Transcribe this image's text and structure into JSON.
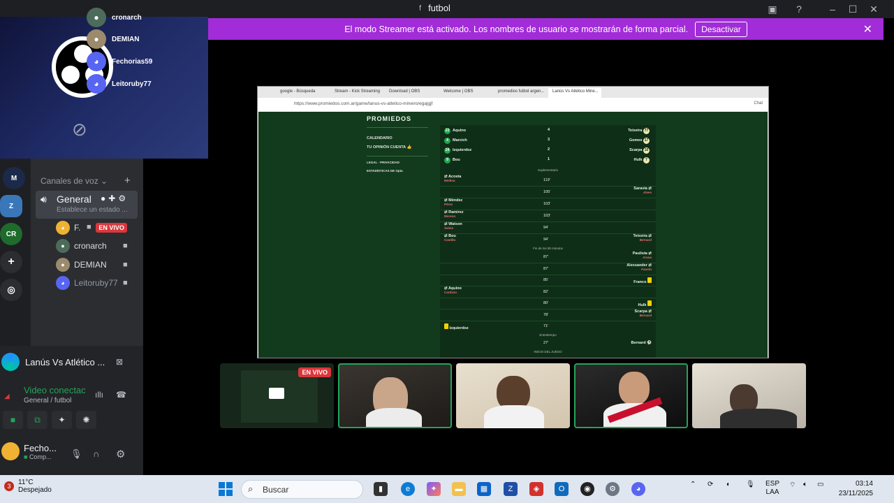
{
  "window": {
    "title": "futbol",
    "hash_icon": "f"
  },
  "streamer_bar": {
    "text": "El modo Streamer está activado. Los nombres de usuario se mostrarán de forma parcial.",
    "button": "Desactivar"
  },
  "overlay_users": [
    "cronarch",
    "DEMIAN",
    "Fechorias59",
    "Leitoruby77"
  ],
  "sidebar": {
    "voice_channels_label": "Canales de voz",
    "channel": {
      "name": "General",
      "status": "Establece un estado ..."
    },
    "voice_users": [
      {
        "name": "F.",
        "live": "EN VIVO"
      },
      {
        "name": "cronarch"
      },
      {
        "name": "DEMIAN"
      },
      {
        "name": "Leitoruby77"
      }
    ]
  },
  "activity": {
    "title": "Lanús Vs Atlético ..."
  },
  "voice": {
    "status": "Video conectac",
    "channel": "General / futbol"
  },
  "user": {
    "name": "Fecho...",
    "sub": "Comp..."
  },
  "browser": {
    "tabs": [
      "google - Búsqueda",
      "Stream - Kick Streaming",
      "Download | OBS",
      "Welcome | OBS",
      "promedios futbol argen...",
      "Lanús Vs Atlético Mine..."
    ],
    "url": "https://www.promiedos.com.ar/game/lanus-vs-atletico-mineiro/egajgjf",
    "chat_label": "Chat"
  },
  "promiedos": {
    "logo": "PROMIEDOS",
    "menu": [
      "CALENDARIO",
      "TU OPINIÓN CUENTA 👍",
      "LEGAL · PRIVACIDAD",
      "ESTADÍSTICAS DE Opta"
    ],
    "penalties": [
      {
        "home_num": "23",
        "home": "Aquino",
        "score": "4",
        "away": "Teixeira",
        "away_num": "77"
      },
      {
        "home_num": "4",
        "home": "Marcich",
        "score": "3",
        "away": "Gomes",
        "away_num": "17"
      },
      {
        "home_num": "24",
        "home": "Izquierdoz",
        "score": "2",
        "away": "Scarpa",
        "away_num": "10"
      },
      {
        "home_num": "9",
        "home": "Bou",
        "score": "1",
        "away": "Hulk",
        "away_num": "7"
      }
    ],
    "sup_label": "Suplementario",
    "events": [
      {
        "min": "119'",
        "home": "Acosta",
        "home_sub": "Medina",
        "away": "",
        "away_sub": ""
      },
      {
        "min": "105'",
        "home": "",
        "home_sub": "",
        "away": "Saravia",
        "away_sub": "Alves"
      },
      {
        "min": "103'",
        "home": "Méndez",
        "home_sub": "Pérez",
        "away": "",
        "away_sub": ""
      },
      {
        "min": "103'",
        "home": "Ramírez",
        "home_sub": "Moreno",
        "away": "",
        "away_sub": ""
      },
      {
        "min": "94'",
        "home": "Watson",
        "home_sub": "Salvio",
        "away": "",
        "away_sub": ""
      },
      {
        "min": "94'",
        "home": "Bou",
        "home_sub": "Castillo",
        "away": "Teixeira",
        "away_sub": "Bernard"
      }
    ],
    "end90_label": "Fin de los 90 minutos",
    "events2": [
      {
        "min": "87'",
        "home": "",
        "away": "Paulista",
        "away_sub": "Arana",
        "card": false
      },
      {
        "min": "87'",
        "home": "",
        "away": "Alexsander",
        "away_sub": "Fausto",
        "card": false
      },
      {
        "min": "85'",
        "home": "",
        "away": "Franco",
        "away_sub": "",
        "card": true
      },
      {
        "min": "82'",
        "home": "Aquino",
        "home_sub": "Cardozo",
        "away": "",
        "away_sub": "",
        "card": false
      },
      {
        "min": "80'",
        "home": "",
        "away": "Hulk",
        "away_sub": "",
        "card": true
      },
      {
        "min": "78'",
        "home": "",
        "away": "Scarpa",
        "away_sub": "Bernard",
        "card": false
      },
      {
        "min": "71'",
        "home": "Izquierdoz",
        "home_sub": "",
        "away": "",
        "away_sub": "",
        "card": true
      }
    ],
    "half_label": "Entretiempo",
    "last": {
      "min": "27'",
      "away": "Bernard"
    },
    "start_label": "INICIO DEL JUEGO"
  },
  "tiles": {
    "live": "EN VIVO"
  },
  "taskbar": {
    "weather_temp": "11°C",
    "weather_desc": "Despejado",
    "weather_badge": "3",
    "search": "Buscar",
    "lang1": "ESP",
    "lang2": "LAA",
    "time": "03:14",
    "date": "23/11/2025"
  }
}
